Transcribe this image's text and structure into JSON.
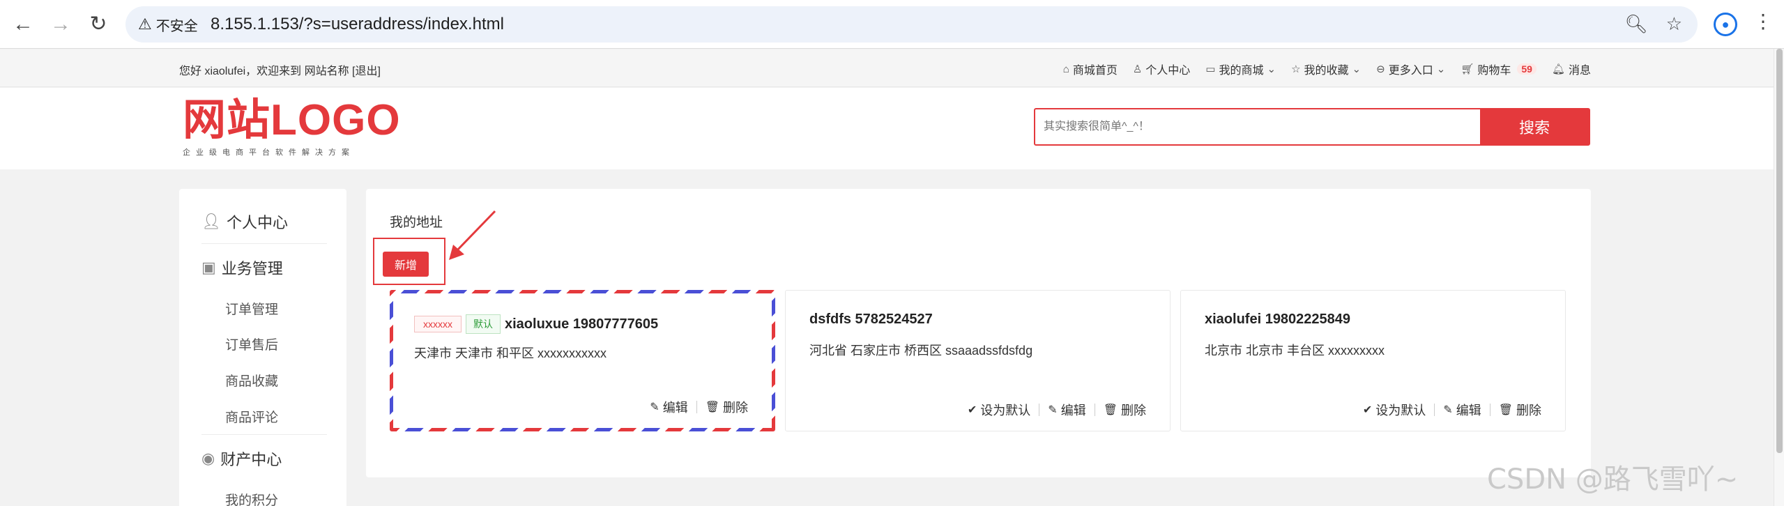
{
  "browser": {
    "security_label": "不安全",
    "url": "8.155.1.153/?s=useraddress/index.html"
  },
  "topbar": {
    "welcome": "您好 xiaolufei，欢迎来到 网站名称 [退出]",
    "nav": [
      {
        "label": "商城首页",
        "icon": "home-icon"
      },
      {
        "label": "个人中心",
        "icon": "user-icon"
      },
      {
        "label": "我的商城",
        "icon": "mall-icon"
      },
      {
        "label": "我的收藏",
        "icon": "star-icon"
      },
      {
        "label": "更多入口",
        "icon": "more-icon"
      },
      {
        "label": "购物车",
        "icon": "cart-icon"
      },
      {
        "label": "消息",
        "icon": "bell-icon"
      }
    ],
    "cart_count": "59"
  },
  "header": {
    "logo_text": "网站LOGO",
    "logo_sub": "企业级电商平台软件解决方案",
    "search_placeholder": "其实搜索很简单^_^！",
    "search_button": "搜索"
  },
  "sidebar": {
    "sections": [
      {
        "label": "个人中心",
        "icon": "person-icon"
      },
      {
        "label": "业务管理",
        "icon": "clipboard-icon"
      },
      {
        "label": "财产中心",
        "icon": "wallet-icon"
      }
    ],
    "business_items": [
      "订单管理",
      "订单售后",
      "商品收藏",
      "商品评论"
    ],
    "asset_items": [
      "我的积分"
    ]
  },
  "main": {
    "title": "我的地址",
    "add_button": "新增",
    "addresses": [
      {
        "alias": "xxxxxx",
        "default_tag": "默认",
        "name_phone": "xiaoluxue 19807777605",
        "address": "天津市 天津市 和平区 xxxxxxxxxxx",
        "edit": "编辑",
        "delete": "删除"
      },
      {
        "name_phone": "dsfdfs 5782524527",
        "address": "河北省 石家庄市 桥西区 ssaaadssfdsfdg",
        "set_default": "设为默认",
        "edit": "编辑",
        "delete": "删除"
      },
      {
        "name_phone": "xiaolufei 19802225849",
        "address": "北京市 北京市 丰台区 xxxxxxxxx",
        "set_default": "设为默认",
        "edit": "编辑",
        "delete": "删除"
      }
    ]
  },
  "watermark": "CSDN @路飞雪吖~",
  "colors": {
    "accent": "#e4393c",
    "default_green": "#2e9d3a",
    "stripe_blue": "#4a4fd6"
  }
}
